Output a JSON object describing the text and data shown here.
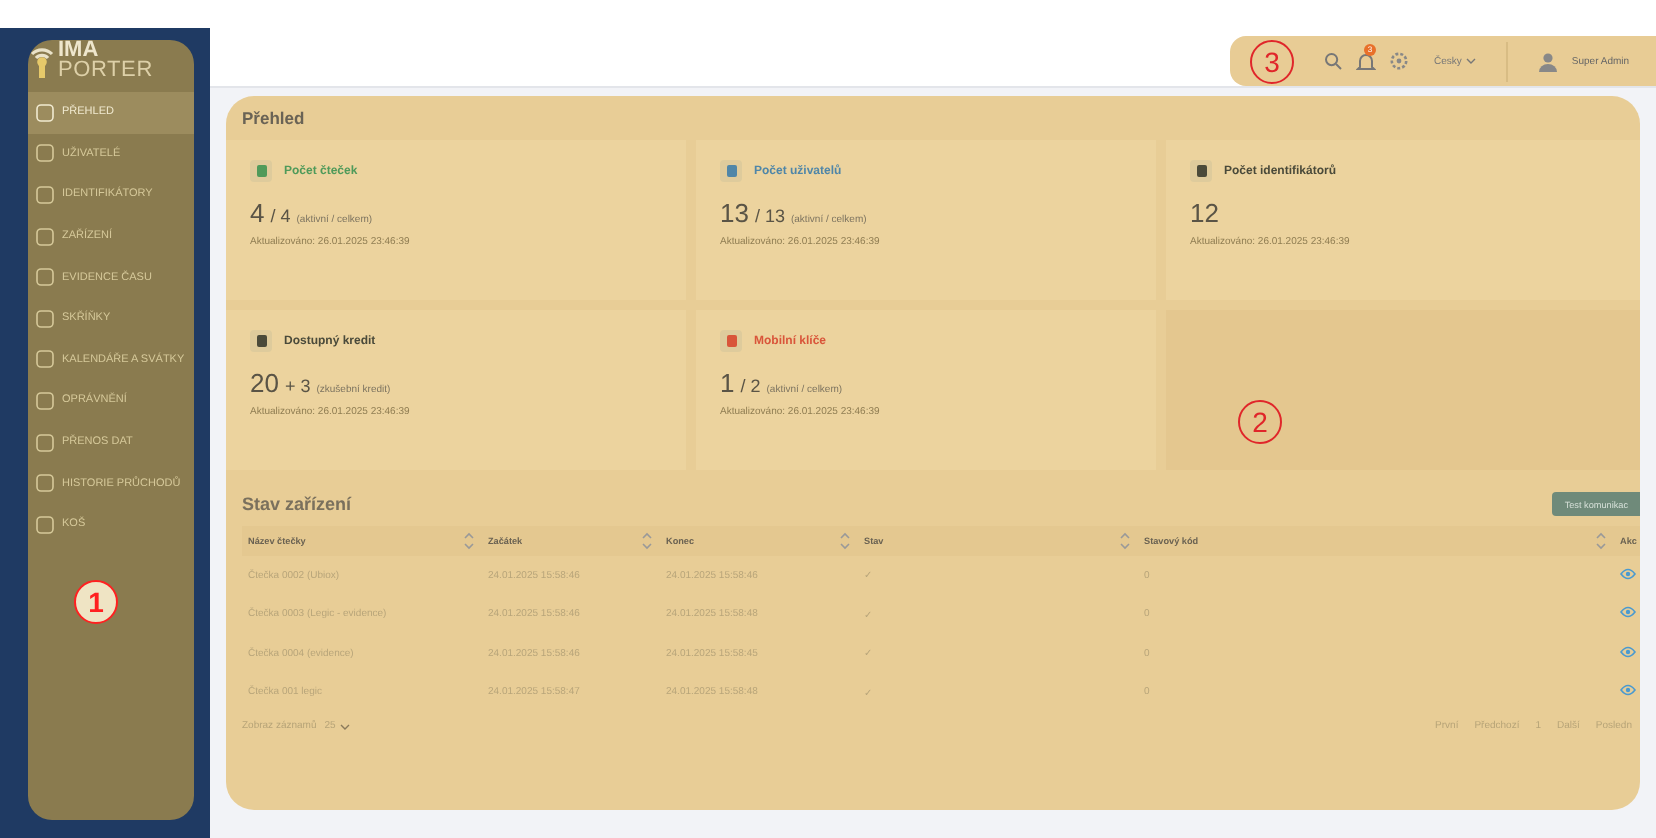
{
  "sidebar": {
    "logo": {
      "line1": "IMA",
      "line2": "PORTER"
    },
    "annotation": "1",
    "items": [
      {
        "label": "PŘEHLED",
        "selected": true
      },
      {
        "label": "UŽIVATELÉ",
        "selected": false
      },
      {
        "label": "IDENTIFIKÁTORY",
        "selected": false
      },
      {
        "label": "ZAŘÍZENÍ",
        "selected": false
      },
      {
        "label": "EVIDENCE ČASU",
        "selected": false
      },
      {
        "label": "SKŘÍŇKY",
        "selected": false
      },
      {
        "label": "KALENDÁŘE A SVÁTKY",
        "selected": false
      },
      {
        "label": "OPRÁVNĚNÍ",
        "selected": false
      },
      {
        "label": "PŘENOS DAT",
        "selected": false
      },
      {
        "label": "HISTORIE PRŮCHODŮ",
        "selected": false
      },
      {
        "label": "KOŠ",
        "selected": false
      }
    ]
  },
  "header": {
    "annotation": "3",
    "notification_count": "3",
    "language": "Česky",
    "user": "Super Admin"
  },
  "main": {
    "annotation": "2",
    "title": "Přehled",
    "cards": [
      {
        "title": "Počet čteček",
        "color": "#4f9a5a",
        "value": "4",
        "second": "/ 4",
        "note": "(aktivní / celkem)",
        "updated": "Aktualizováno: 26.01.2025 23:46:39"
      },
      {
        "title": "Počet uživatelů",
        "color": "#4f86a8",
        "value": "13",
        "second": "/ 13",
        "note": "(aktivní / celkem)",
        "updated": "Aktualizováno: 26.01.2025 23:46:39"
      },
      {
        "title": "Počet identifikátorů",
        "color": "#4a4a3a",
        "value": "12",
        "updated": "Aktualizováno: 26.01.2025 23:46:39"
      },
      {
        "title": "Dostupný kredit",
        "color": "#4a4a3a",
        "value": "20",
        "second": "+ 3",
        "note": "(zkušební kredit)",
        "updated": "Aktualizováno: 26.01.2025 23:46:39"
      },
      {
        "title": "Mobilní klíče",
        "color": "#d9553a",
        "value": "1",
        "second": "/ 2",
        "note": "(aktivní / celkem)",
        "updated": "Aktualizováno: 26.01.2025 23:46:39"
      }
    ],
    "devices": {
      "title": "Stav zařízení",
      "button": "Test komunikac",
      "columns": [
        "Název čtečky",
        "Začátek",
        "Konec",
        "Stav",
        "Stavový kód",
        "Akc"
      ],
      "rows": [
        [
          "Čtečka 0002 (Ubiox)",
          "24.01.2025 15:58:46",
          "24.01.2025 15:58:46",
          "✓",
          "0"
        ],
        [
          "Čtečka 0003 (Legic - evidence)",
          "24.01.2025 15:58:46",
          "24.01.2025 15:58:48",
          "✓",
          "0"
        ],
        [
          "Čtečka 0004 (evidence)",
          "24.01.2025 15:58:46",
          "24.01.2025 15:58:45",
          "✓",
          "0"
        ],
        [
          "Čtečka 001 legic",
          "24.01.2025 15:58:47",
          "24.01.2025 15:58:48",
          "✓",
          "0"
        ]
      ],
      "page_size_label": "Zobraz záznamů",
      "page_size": "25",
      "pagination": [
        "První",
        "Předchozí",
        "1",
        "Další",
        "Posledn"
      ]
    }
  }
}
